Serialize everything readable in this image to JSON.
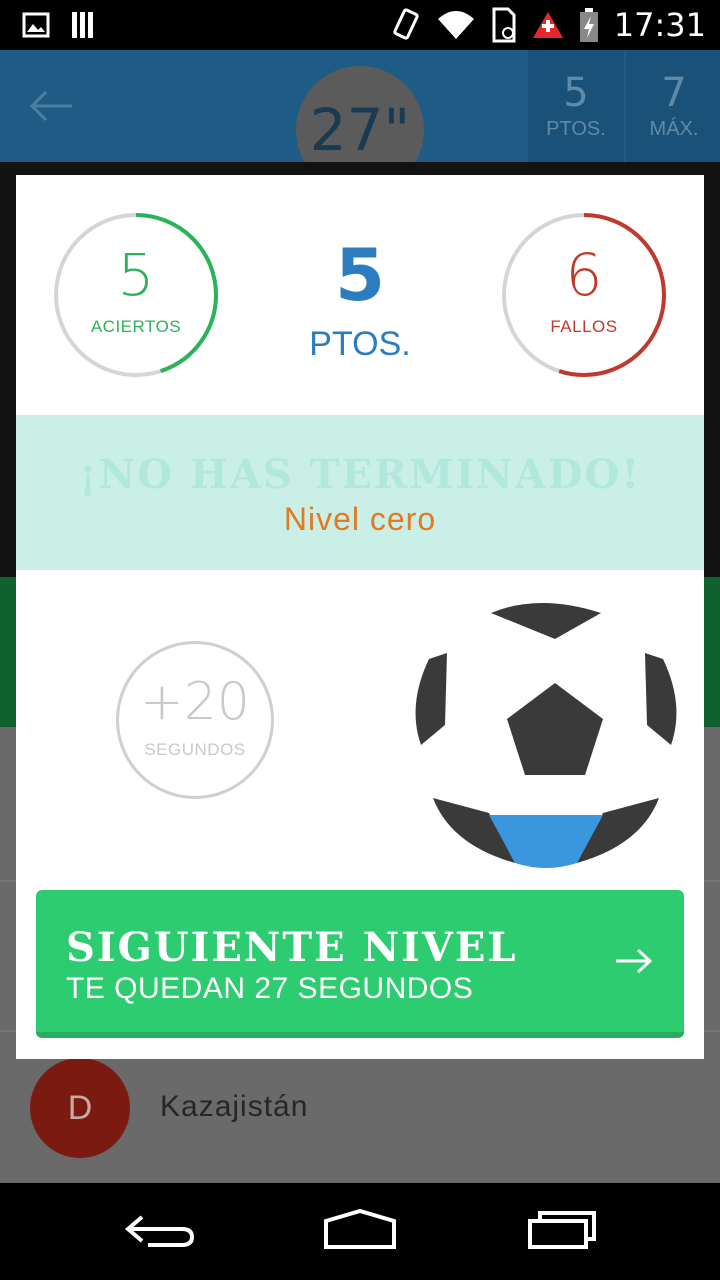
{
  "status_bar": {
    "time": "17:31",
    "icons": [
      "image-icon",
      "storage-icon",
      "vibrate-icon",
      "wifi-icon",
      "sim-icon",
      "alert-icon",
      "battery-icon"
    ]
  },
  "header": {
    "timer": "27\"",
    "points_value": "5",
    "points_label": "PTOS.",
    "max_value": "7",
    "max_label": "MÁX."
  },
  "background_list": {
    "avatar_letter": "D",
    "country": "Kazajistán"
  },
  "modal": {
    "aciertos": {
      "value": "5",
      "label": "ACIERTOS",
      "fraction": 0.45
    },
    "points": {
      "value": "5",
      "label": "PTOS."
    },
    "fallos": {
      "value": "6",
      "label": "FALLOS",
      "fraction": 0.55
    },
    "banner": {
      "title": "¡NO HAS TERMINADO!",
      "subtitle": "Nivel cero"
    },
    "bonus": {
      "value": "+20",
      "label": "SEGUNDOS"
    },
    "next_button": {
      "title": "SIGUIENTE NIVEL",
      "subtitle": "TE QUEDAN 27 SEGUNDOS"
    }
  },
  "colors": {
    "correct": "#2cb35a",
    "wrong": "#c0392b",
    "points": "#2b7dbf",
    "banner_bg": "#c9efe6",
    "subtitle": "#e07b22",
    "button": "#2ecc71"
  }
}
